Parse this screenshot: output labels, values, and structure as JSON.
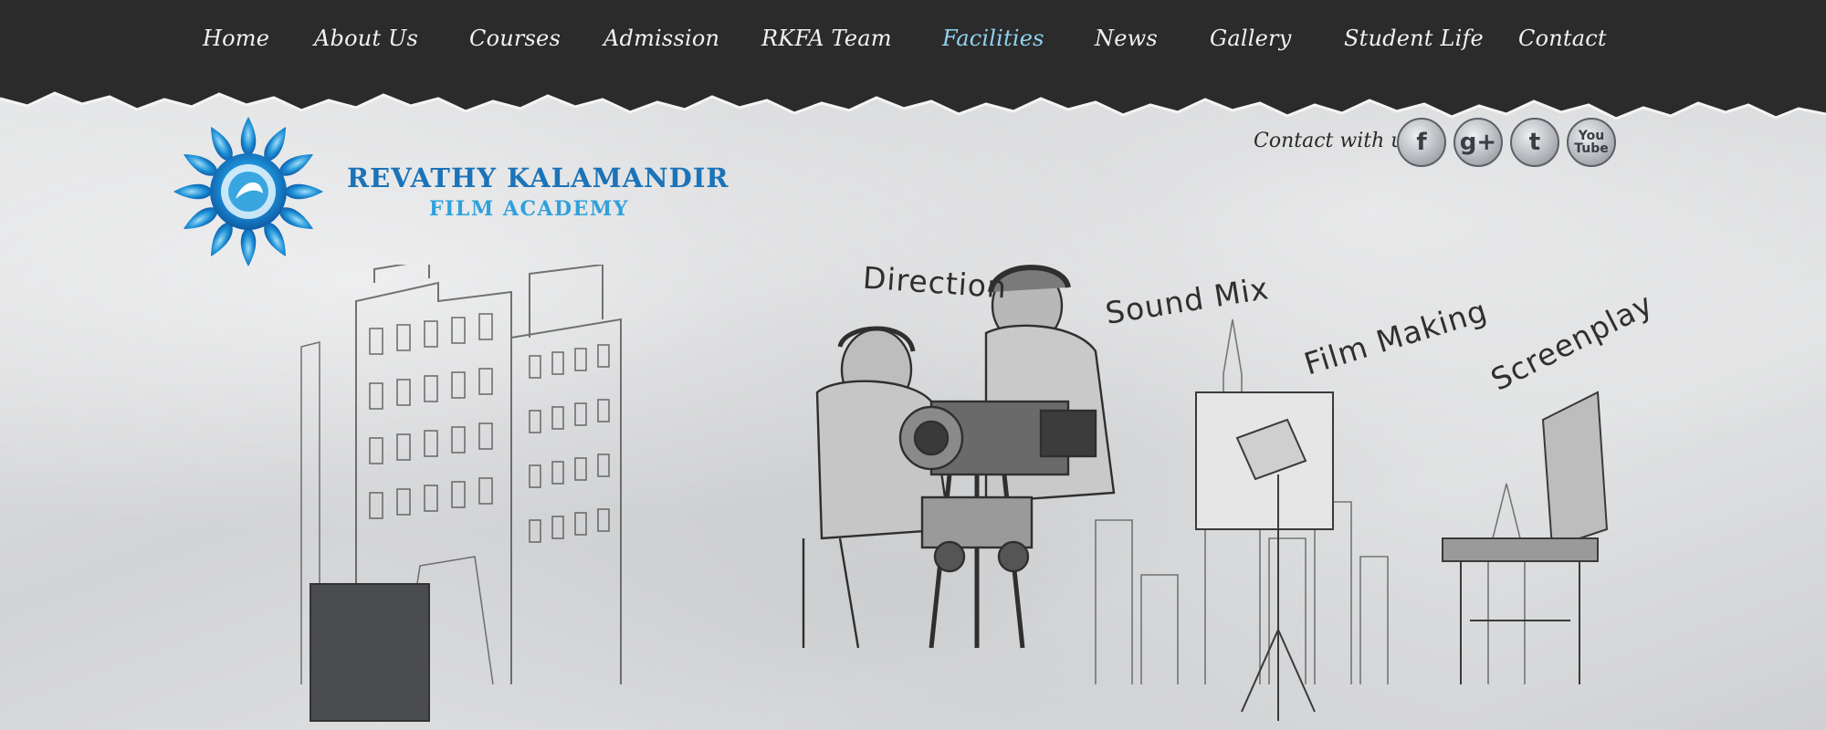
{
  "nav": {
    "items": [
      {
        "label": "Home"
      },
      {
        "label": "About Us"
      },
      {
        "label": "Courses"
      },
      {
        "label": "Admission"
      },
      {
        "label": "RKFA Team"
      },
      {
        "label": "Facilities",
        "active": true
      },
      {
        "label": "News"
      },
      {
        "label": "Gallery"
      },
      {
        "label": "Student Life"
      },
      {
        "label": "Contact"
      }
    ]
  },
  "brand": {
    "name": "REVATHY KALAMANDIR",
    "subtitle": "FILM ACADEMY"
  },
  "contact": {
    "label": "Contact with us",
    "social": [
      {
        "name": "facebook",
        "glyph": "f"
      },
      {
        "name": "google-plus",
        "glyph": "g+"
      },
      {
        "name": "twitter",
        "glyph": "t"
      },
      {
        "name": "youtube",
        "glyph": "You Tube"
      }
    ]
  },
  "banner": {
    "subjects": [
      "Direction",
      "Sound Mix",
      "Film Making",
      "Screenplay"
    ]
  },
  "colors": {
    "nav_bg": "#2b2b2b",
    "nav_text": "#f2f2f2",
    "nav_active": "#8fd3f0",
    "brand_primary": "#1b73b8",
    "brand_secondary": "#2fa1dc"
  }
}
